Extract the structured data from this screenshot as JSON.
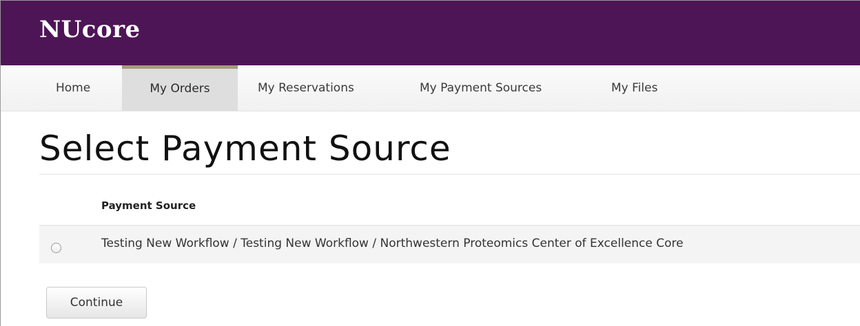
{
  "app": {
    "brand": "NUcore"
  },
  "nav": {
    "items": [
      {
        "label": "Home"
      },
      {
        "label": "My Orders",
        "active": true
      },
      {
        "label": "My Reservations"
      },
      {
        "label": "My Payment Sources"
      },
      {
        "label": "My Files"
      }
    ]
  },
  "main": {
    "title": "Select Payment Source",
    "table": {
      "headers": [
        "Payment Source"
      ],
      "rows": [
        {
          "label": "Testing New Workflow / Testing New Workflow / Northwestern Proteomics Center of Excellence Core",
          "selected": false
        }
      ]
    },
    "continue_label": "Continue"
  },
  "colors": {
    "brand_bar": "#4e1556",
    "active_tab_accent": "#a69b7a"
  },
  "icons": {
    "radio": "radio-unselected-icon"
  }
}
